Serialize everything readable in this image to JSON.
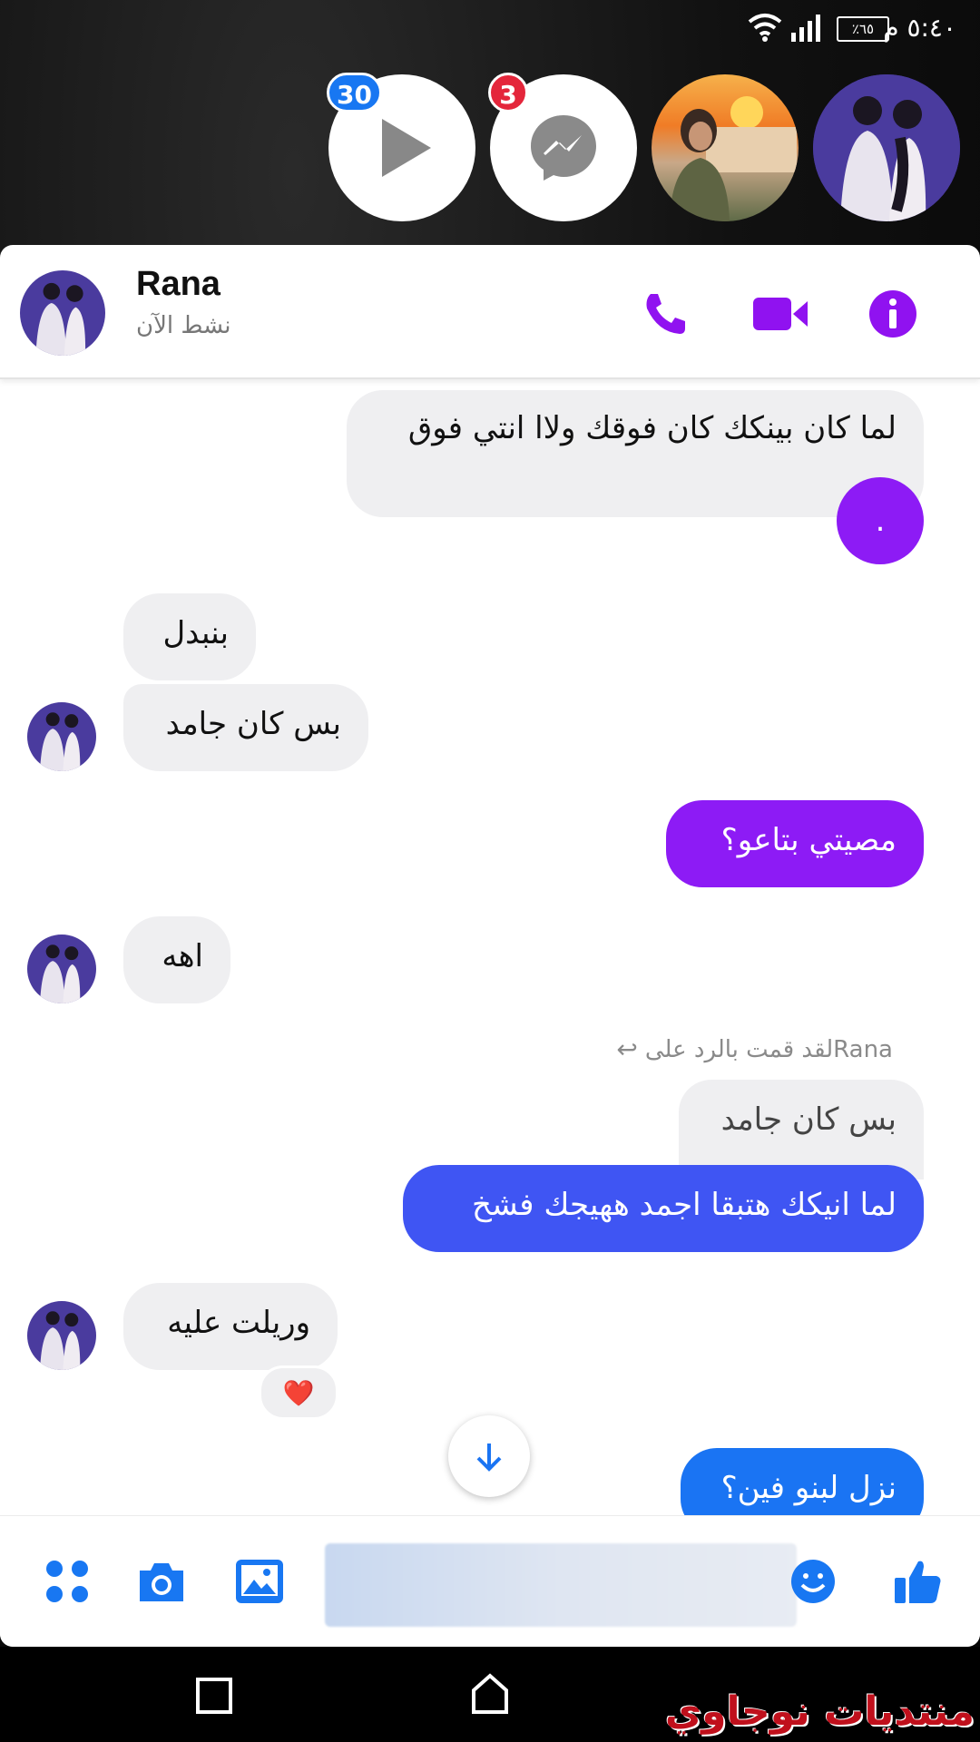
{
  "status_bar": {
    "time": "٥:٤٠ م",
    "battery": "٪٦٥"
  },
  "chat_heads": [
    {
      "badge": "30"
    },
    {
      "badge": "3"
    },
    {},
    {}
  ],
  "header": {
    "name": "Rana",
    "status": "نشط الآن"
  },
  "messages": {
    "m1": "لما كان بينكك كان فوقك ولاا انتي فوق",
    "m1_dot": ".",
    "m2": "بنبدل",
    "m3": "بس كان جامد",
    "m4": "مصيتي بتاعو؟",
    "m5": "اهه",
    "reply_label": "Ranaلقد قمت بالرد على",
    "quote": "بس كان جامد",
    "m6": "لما انيكك هتبقا اجمد ههيجك فشخ",
    "m7": "وريلت عليه",
    "m8": "نزل لبنو فين؟"
  },
  "reaction": "❤️",
  "watermark": "منتديات نوجاوي",
  "colors": {
    "purple": "#8d1bf5",
    "blue": "#3f55f3",
    "azure": "#1a74f3",
    "messenger_blue": "#1877f2"
  }
}
